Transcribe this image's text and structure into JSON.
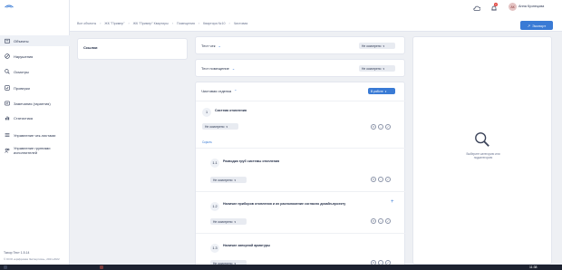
{
  "header": {
    "user_name": "Анна Кузнецова",
    "avatar_initials": "АК",
    "notification_count": "9",
    "export_label": "Экспорт"
  },
  "breadcrumb": [
    "Все объекты",
    "ЖК \"Пример\"",
    "ЖК \"Пример\" Квартиры",
    "Помещения",
    "Квартира №10",
    "Чистовая"
  ],
  "sidebar": {
    "items": [
      {
        "label": "Объекты",
        "icon": "building-icon"
      },
      {
        "label": "Нарушения",
        "icon": "violation-icon"
      },
      {
        "label": "Осмотры",
        "icon": "search-icon"
      },
      {
        "label": "Проверки",
        "icon": "check-icon"
      },
      {
        "label": "Замечания (гарантия)",
        "icon": "warranty-icon"
      },
      {
        "label": "Статистика",
        "icon": "chart-icon"
      },
      {
        "label": "Управление чек-листами",
        "icon": "checklist-icon"
      },
      {
        "label": "Управление группами исполнителей",
        "icon": "group-icon"
      }
    ],
    "version": "Тахор Тест 1.5.14",
    "copyright": "© ООО «Цифровая Экспертиза», 2021-2022"
  },
  "links_card": {
    "title": "Ссылки"
  },
  "sections": [
    {
      "title": "Тест чек",
      "status": "Не осмотрено"
    },
    {
      "title": "Тест помещение",
      "status": "Не осмотрено"
    },
    {
      "title": "Чистовая отделка",
      "status": "В работе"
    }
  ],
  "checklist": {
    "group_number": "1",
    "group_title": "Система отопления",
    "group_status": "Не осмотрено",
    "hide_label": "Скрыть",
    "items": [
      {
        "number": "1.1",
        "title": "Разводка труб системы отопления",
        "status": "Не осмотрено"
      },
      {
        "number": "1.2",
        "title": "Наличие приборов отопления и их расположение согласно дизайн-проекту",
        "status": "Не осмотрено"
      },
      {
        "number": "1.3",
        "title": "Наличие запорной арматуры",
        "status": "Не осмотрено"
      }
    ]
  },
  "right_panel": {
    "empty_text": "Выберите категорию или подкатегорию"
  },
  "taskbar": {
    "clock": "11:38"
  },
  "colors": {
    "accent": "#3a7bd5",
    "badge": "#e3413a"
  }
}
